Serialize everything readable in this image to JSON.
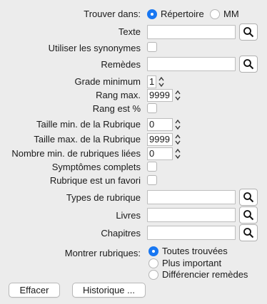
{
  "find_in": {
    "label": "Trouver dans:",
    "options": [
      "Répertoire",
      "MM"
    ],
    "selected": "Répertoire"
  },
  "texte": {
    "label": "Texte",
    "value": ""
  },
  "synonymes": {
    "label": "Utiliser les synonymes",
    "checked": false
  },
  "remedes": {
    "label": "Remèdes",
    "value": ""
  },
  "grade_min": {
    "label": "Grade minimum",
    "value": "1"
  },
  "rang_max": {
    "label": "Rang max.",
    "value": "9999"
  },
  "rang_pct": {
    "label": "Rang est %",
    "checked": false
  },
  "taille_min": {
    "label": "Taille min. de la Rubrique",
    "value": "0"
  },
  "taille_max": {
    "label": "Taille max. de la Rubrique",
    "value": "9999"
  },
  "nombre_min": {
    "label": "Nombre min. de rubriques liées",
    "value": "0"
  },
  "symptomes": {
    "label": "Symptômes complets",
    "checked": false
  },
  "favori": {
    "label": "Rubrique est un favori",
    "checked": false
  },
  "types": {
    "label": "Types de rubrique",
    "value": ""
  },
  "livres": {
    "label": "Livres",
    "value": ""
  },
  "chapitres": {
    "label": "Chapitres",
    "value": ""
  },
  "montrer": {
    "label": "Montrer rubriques:",
    "options": [
      "Toutes trouvées",
      "Plus important",
      "Différencier remèdes"
    ],
    "selected": "Toutes trouvées"
  },
  "buttons": {
    "effacer": "Effacer",
    "historique": "Historique ..."
  },
  "colors": {
    "accent": "#1877f2",
    "background": "#ececec"
  },
  "icons": [
    "search-icon",
    "stepper-icon"
  ]
}
